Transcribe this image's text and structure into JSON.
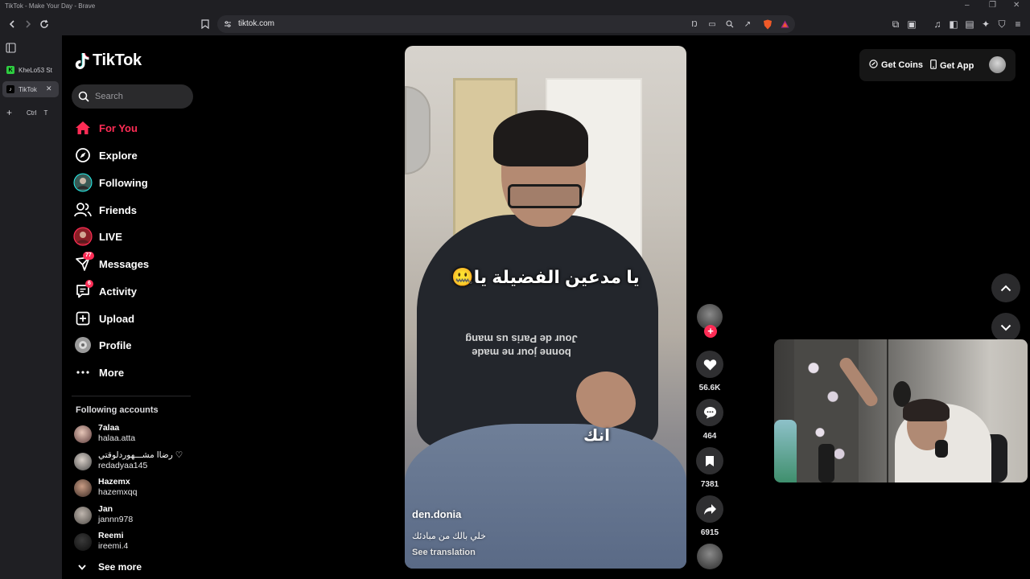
{
  "window": {
    "title": "TikTok - Make Your Day - Brave"
  },
  "browser": {
    "url": "tiktok.com",
    "tabs": [
      {
        "label": "KheLo53 St",
        "active": false
      },
      {
        "label": "TikTok",
        "active": true
      }
    ],
    "new_tab": {
      "label": "Ctrl",
      "shortcut": "T"
    }
  },
  "sidebar": {
    "logo": "TikTok",
    "search_placeholder": "Search",
    "nav": [
      {
        "label": "For You",
        "icon": "home-icon",
        "active": true
      },
      {
        "label": "Explore",
        "icon": "compass-icon"
      },
      {
        "label": "Following",
        "icon": "following-avatar-icon"
      },
      {
        "label": "Friends",
        "icon": "friends-icon"
      },
      {
        "label": "LIVE",
        "icon": "live-icon"
      },
      {
        "label": "Messages",
        "icon": "messages-icon",
        "badge": "77"
      },
      {
        "label": "Activity",
        "icon": "activity-icon",
        "badge": "6"
      },
      {
        "label": "Upload",
        "icon": "upload-icon"
      },
      {
        "label": "Profile",
        "icon": "profile-icon"
      },
      {
        "label": "More",
        "icon": "more-icon"
      }
    ],
    "following_title": "Following accounts",
    "accounts": [
      {
        "name": "7alaa",
        "handle": "halaa.atta"
      },
      {
        "name": "رضاا مشـــهوردلوقتي ♡",
        "handle": "redadyaa145"
      },
      {
        "name": "Hazemx",
        "handle": "hazemxqq"
      },
      {
        "name": "Jan",
        "handle": "jannn978"
      },
      {
        "name": "Reemi",
        "handle": "ireemi.4"
      }
    ],
    "see_more": "See more"
  },
  "video": {
    "caption_top": "يا مدعين الفضيلة يا🤐",
    "caption_mid": "انك",
    "hoodie_print": "bonne jour ne made\nJour de Paris us mang",
    "author": "den.donia",
    "description": "خلي بالك من مبادئك",
    "see_translation": "See translation"
  },
  "actions": {
    "likes": "56.6K",
    "comments": "464",
    "saves": "7381",
    "shares": "6915"
  },
  "top_right": {
    "get_coins": "Get Coins",
    "get_app": "Get App"
  },
  "colors": {
    "accent": "#fe2c55",
    "background": "#000000",
    "browser_chrome": "#1f1f23"
  }
}
